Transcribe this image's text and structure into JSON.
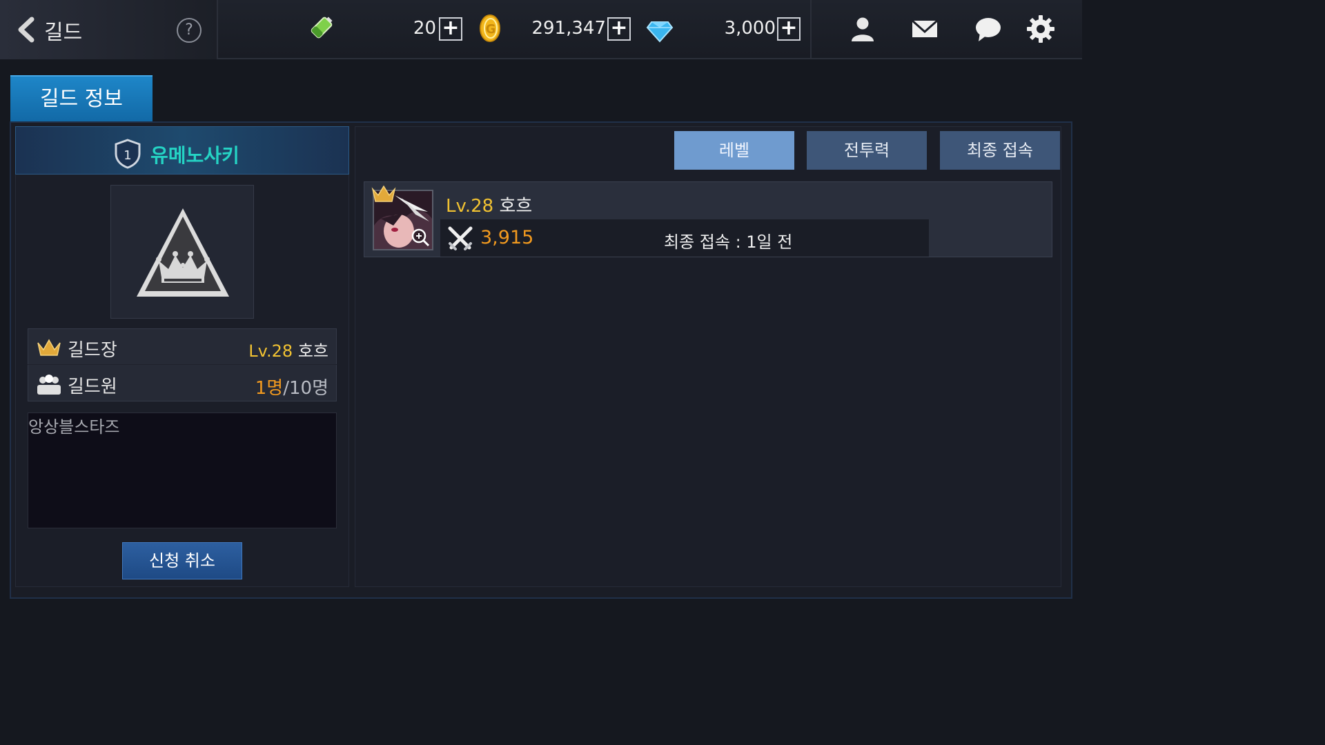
{
  "header": {
    "title": "길드",
    "help_label": "?",
    "stamina": "20",
    "gold": "291,347",
    "gems": "3,000",
    "plus_label": "+"
  },
  "tabs": {
    "guild_info": "길드 정보"
  },
  "guild": {
    "rank": "1",
    "name": "유메노사키",
    "leader_label": "길드장",
    "leader_level": "Lv.28",
    "leader_name": "호흐",
    "members_label": "길드원",
    "members_current": "1명",
    "members_separator": "/",
    "members_max": "10명",
    "description": "앙상블스타즈",
    "cancel_button": "신청 취소"
  },
  "sort_buttons": {
    "level": "레벨",
    "power": "전투력",
    "last_login": "최종 접속"
  },
  "members": [
    {
      "level": "Lv.28",
      "name": "호흐",
      "power": "3,915",
      "last_login": "최종 접속 : 1일 전"
    }
  ],
  "colors": {
    "accent_blue": "#1e86c8",
    "guild_name": "#25d3c4",
    "level_yellow": "#f1c232",
    "power_orange": "#f29a1f"
  },
  "icons": {
    "back": "chevron-left-icon",
    "help": "question-icon",
    "stamina": "battery-icon",
    "gold": "coin-icon",
    "gem": "diamond-icon",
    "friends": "person-icon",
    "mail": "envelope-icon",
    "chat": "speech-bubble-icon",
    "settings": "gear-icon"
  }
}
